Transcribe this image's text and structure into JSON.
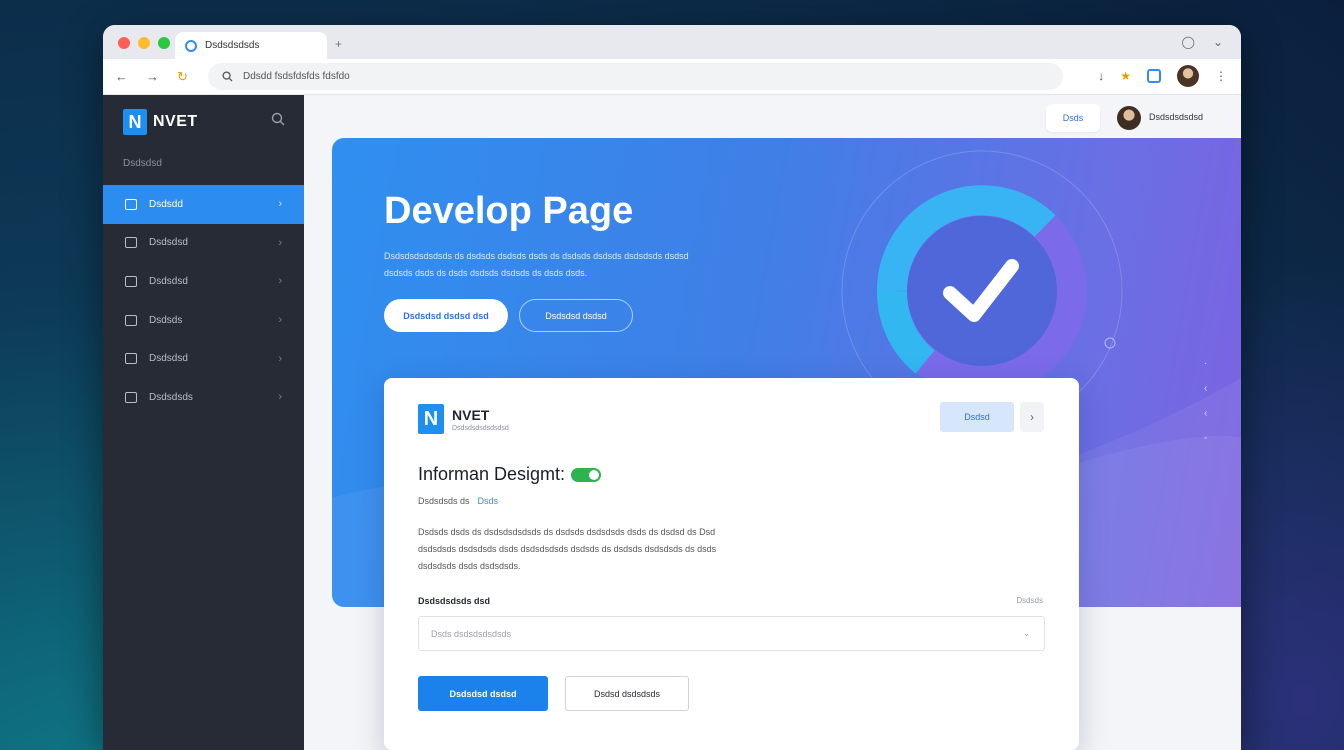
{
  "colors": {
    "accent": "#2c8cf0",
    "sidebar_bg": "#262b36",
    "hero_start": "#2f8ff0",
    "hero_end": "#7d62e0",
    "primary_button": "#1a82ea",
    "toggle_on": "#2db34f"
  },
  "browser": {
    "tab_title": "Dsdsdsdsds",
    "new_tab_icon": "plus-icon",
    "url": "Ddsdd fsdsfdsfds fdsfdo"
  },
  "sidebar": {
    "brand": "NVET",
    "logo_letter": "N",
    "section_label": "Dsdsdsd",
    "items": [
      {
        "label": "Dsdsdd",
        "icon": "dashboard-icon",
        "active": true
      },
      {
        "label": "Dsdsdsd",
        "icon": "grid-icon",
        "active": false
      },
      {
        "label": "Dsdsdsd",
        "icon": "chart-icon",
        "active": false
      },
      {
        "label": "Dsdsds",
        "icon": "layers-icon",
        "active": false
      },
      {
        "label": "Dsdsdsd",
        "icon": "window-icon",
        "active": false
      },
      {
        "label": "Dsdsdsds",
        "icon": "settings-icon",
        "active": false
      }
    ]
  },
  "topbar": {
    "button_label": "Dsds",
    "user_name": "Dsdsdsdsdsd"
  },
  "hero": {
    "title": "Develop Page",
    "description_line1": "Dsdsdsdsdsdsds ds dsdsds dsdsds dsds ds dsdsds dsdsds dsdsdsds dsdsd",
    "description_line2": "dsdsds dsds ds dsds dsdsds dsdsds ds dsds dsds.",
    "primary_button": "Dsdsdsd dsdsd dsd",
    "secondary_button": "Dsdsdsd dsdsd"
  },
  "card": {
    "brand": "NVET",
    "logo_letter": "N",
    "brand_subtitle": "Dsdsdsdsdsdsdsd",
    "top_button": "Dsdsd",
    "title": "Informan Desigmt:",
    "meta": "Dsdsdsds ds",
    "meta_tag": "Dsds",
    "body_line1": "Dsdsds dsds ds dsdsdsdsdsds ds dsdsds dsdsdsds dsds ds dsdsd ds Dsd",
    "body_line2": "dsdsdsds dsdsdsds dsds dsdsdsdsds dsdsds ds dsdsds dsdsdsds ds dsds",
    "body_line3": "dsdsdsds dsds dsdsdsds.",
    "field_label": "Dsdsdsdsds dsd",
    "field_hint": "Dsdsds",
    "select_placeholder": "Dsds dsdsdsdsdsds",
    "primary_button": "Dsdsdsd dsdsd",
    "secondary_button": "Dsdsd dsdsdsds"
  }
}
